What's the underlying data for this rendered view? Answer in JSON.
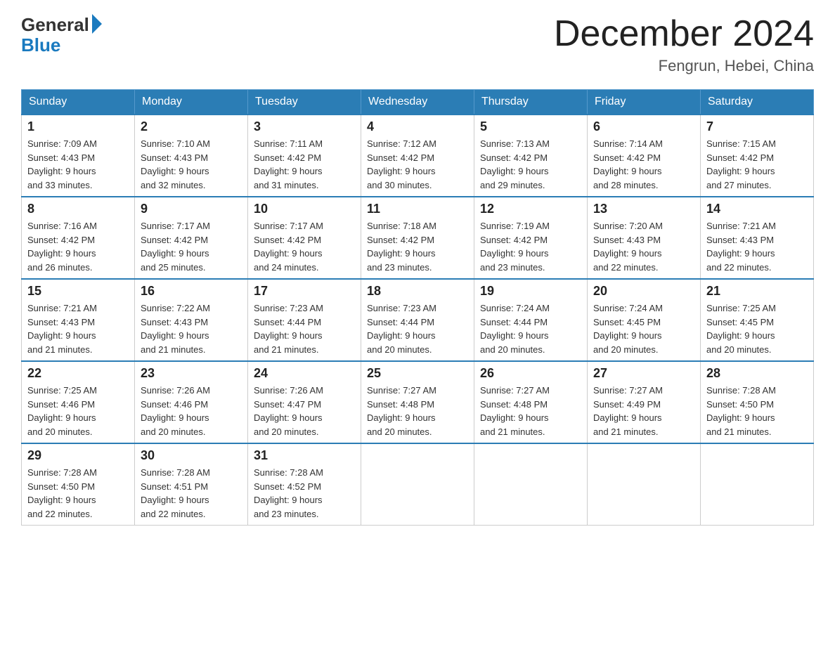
{
  "header": {
    "logo_general": "General",
    "logo_blue": "Blue",
    "month_title": "December 2024",
    "location": "Fengrun, Hebei, China"
  },
  "days_of_week": [
    "Sunday",
    "Monday",
    "Tuesday",
    "Wednesday",
    "Thursday",
    "Friday",
    "Saturday"
  ],
  "weeks": [
    [
      {
        "day": "1",
        "sunrise": "7:09 AM",
        "sunset": "4:43 PM",
        "daylight": "9 hours and 33 minutes."
      },
      {
        "day": "2",
        "sunrise": "7:10 AM",
        "sunset": "4:43 PM",
        "daylight": "9 hours and 32 minutes."
      },
      {
        "day": "3",
        "sunrise": "7:11 AM",
        "sunset": "4:42 PM",
        "daylight": "9 hours and 31 minutes."
      },
      {
        "day": "4",
        "sunrise": "7:12 AM",
        "sunset": "4:42 PM",
        "daylight": "9 hours and 30 minutes."
      },
      {
        "day": "5",
        "sunrise": "7:13 AM",
        "sunset": "4:42 PM",
        "daylight": "9 hours and 29 minutes."
      },
      {
        "day": "6",
        "sunrise": "7:14 AM",
        "sunset": "4:42 PM",
        "daylight": "9 hours and 28 minutes."
      },
      {
        "day": "7",
        "sunrise": "7:15 AM",
        "sunset": "4:42 PM",
        "daylight": "9 hours and 27 minutes."
      }
    ],
    [
      {
        "day": "8",
        "sunrise": "7:16 AM",
        "sunset": "4:42 PM",
        "daylight": "9 hours and 26 minutes."
      },
      {
        "day": "9",
        "sunrise": "7:17 AM",
        "sunset": "4:42 PM",
        "daylight": "9 hours and 25 minutes."
      },
      {
        "day": "10",
        "sunrise": "7:17 AM",
        "sunset": "4:42 PM",
        "daylight": "9 hours and 24 minutes."
      },
      {
        "day": "11",
        "sunrise": "7:18 AM",
        "sunset": "4:42 PM",
        "daylight": "9 hours and 23 minutes."
      },
      {
        "day": "12",
        "sunrise": "7:19 AM",
        "sunset": "4:42 PM",
        "daylight": "9 hours and 23 minutes."
      },
      {
        "day": "13",
        "sunrise": "7:20 AM",
        "sunset": "4:43 PM",
        "daylight": "9 hours and 22 minutes."
      },
      {
        "day": "14",
        "sunrise": "7:21 AM",
        "sunset": "4:43 PM",
        "daylight": "9 hours and 22 minutes."
      }
    ],
    [
      {
        "day": "15",
        "sunrise": "7:21 AM",
        "sunset": "4:43 PM",
        "daylight": "9 hours and 21 minutes."
      },
      {
        "day": "16",
        "sunrise": "7:22 AM",
        "sunset": "4:43 PM",
        "daylight": "9 hours and 21 minutes."
      },
      {
        "day": "17",
        "sunrise": "7:23 AM",
        "sunset": "4:44 PM",
        "daylight": "9 hours and 21 minutes."
      },
      {
        "day": "18",
        "sunrise": "7:23 AM",
        "sunset": "4:44 PM",
        "daylight": "9 hours and 20 minutes."
      },
      {
        "day": "19",
        "sunrise": "7:24 AM",
        "sunset": "4:44 PM",
        "daylight": "9 hours and 20 minutes."
      },
      {
        "day": "20",
        "sunrise": "7:24 AM",
        "sunset": "4:45 PM",
        "daylight": "9 hours and 20 minutes."
      },
      {
        "day": "21",
        "sunrise": "7:25 AM",
        "sunset": "4:45 PM",
        "daylight": "9 hours and 20 minutes."
      }
    ],
    [
      {
        "day": "22",
        "sunrise": "7:25 AM",
        "sunset": "4:46 PM",
        "daylight": "9 hours and 20 minutes."
      },
      {
        "day": "23",
        "sunrise": "7:26 AM",
        "sunset": "4:46 PM",
        "daylight": "9 hours and 20 minutes."
      },
      {
        "day": "24",
        "sunrise": "7:26 AM",
        "sunset": "4:47 PM",
        "daylight": "9 hours and 20 minutes."
      },
      {
        "day": "25",
        "sunrise": "7:27 AM",
        "sunset": "4:48 PM",
        "daylight": "9 hours and 20 minutes."
      },
      {
        "day": "26",
        "sunrise": "7:27 AM",
        "sunset": "4:48 PM",
        "daylight": "9 hours and 21 minutes."
      },
      {
        "day": "27",
        "sunrise": "7:27 AM",
        "sunset": "4:49 PM",
        "daylight": "9 hours and 21 minutes."
      },
      {
        "day": "28",
        "sunrise": "7:28 AM",
        "sunset": "4:50 PM",
        "daylight": "9 hours and 21 minutes."
      }
    ],
    [
      {
        "day": "29",
        "sunrise": "7:28 AM",
        "sunset": "4:50 PM",
        "daylight": "9 hours and 22 minutes."
      },
      {
        "day": "30",
        "sunrise": "7:28 AM",
        "sunset": "4:51 PM",
        "daylight": "9 hours and 22 minutes."
      },
      {
        "day": "31",
        "sunrise": "7:28 AM",
        "sunset": "4:52 PM",
        "daylight": "9 hours and 23 minutes."
      },
      null,
      null,
      null,
      null
    ]
  ]
}
